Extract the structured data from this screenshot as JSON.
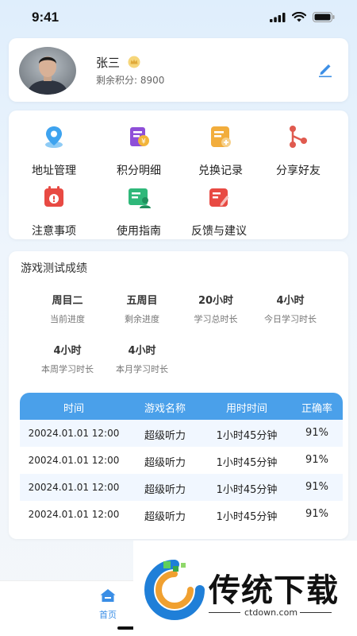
{
  "status_bar": {
    "time": "9:41"
  },
  "profile": {
    "name": "张三",
    "points_label": "剩余积分:",
    "points": "8900"
  },
  "menu": [
    {
      "label": "地址管理",
      "icon": "location-pin-icon"
    },
    {
      "label": "积分明细",
      "icon": "points-detail-icon"
    },
    {
      "label": "兑换记录",
      "icon": "exchange-record-icon"
    },
    {
      "label": "分享好友",
      "icon": "share-icon"
    },
    {
      "label": "注意事项",
      "icon": "notice-icon"
    },
    {
      "label": "使用指南",
      "icon": "guide-icon"
    },
    {
      "label": "反馈与建议",
      "icon": "feedback-icon"
    }
  ],
  "stats": {
    "title": "游戏测试成绩",
    "items": [
      {
        "value": "周目二",
        "label": "当前进度"
      },
      {
        "value": "五周目",
        "label": "剩余进度"
      },
      {
        "value": "20小时",
        "label": "学习总时长"
      },
      {
        "value": "4小时",
        "label": "今日学习时长"
      },
      {
        "value": "4小时",
        "label": "本周学习时长"
      },
      {
        "value": "4小时",
        "label": "本月学习时长"
      }
    ],
    "table": {
      "headers": [
        "时间",
        "游戏名称",
        "用时时间",
        "正确率"
      ],
      "rows": [
        [
          "20024.01.01 12:00",
          "超级听力",
          "1小时45分钟",
          "91%"
        ],
        [
          "20024.01.01 12:00",
          "超级听力",
          "1小时45分钟",
          "91%"
        ],
        [
          "20024.01.01 12:00",
          "超级听力",
          "1小时45分钟",
          "91%"
        ],
        [
          "20024.01.01 12:00",
          "超级听力",
          "1小时45分钟",
          "91%"
        ]
      ]
    }
  },
  "tabbar": {
    "home_label": "首页"
  },
  "watermark": {
    "title": "传统下载",
    "url": "ctdown.com"
  },
  "colors": {
    "accent": "#4aa0ea",
    "tab_active": "#3a8ee6"
  }
}
